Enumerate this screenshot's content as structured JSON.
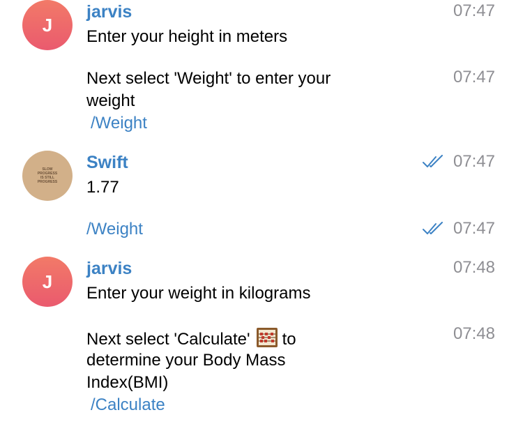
{
  "messages": [
    {
      "sender": "jarvis",
      "avatar_letter": "J",
      "text": "Enter your height in meters",
      "time": "07:47"
    },
    {
      "text_line1": "Next select 'Weight' to enter your",
      "text_line2": "weight",
      "command": "/Weight",
      "time": "07:47"
    },
    {
      "sender": "Swift",
      "avatar_text": [
        "SLOW",
        "PROGRESS",
        "IS STILL",
        "PROGRESS"
      ],
      "text": "1.77",
      "time": "07:47",
      "status": "read"
    },
    {
      "command": "/Weight",
      "time": "07:47",
      "status": "read"
    },
    {
      "sender": "jarvis",
      "avatar_letter": "J",
      "text": "Enter your weight in kilograms",
      "time": "07:48"
    },
    {
      "text_line1_before": "Next select 'Calculate'",
      "text_line1_after": "to",
      "emoji_icon": "abacus-icon",
      "text_line2": "determine your Body Mass",
      "text_line3": "Index(BMI)",
      "command": "/Calculate",
      "time": "07:48"
    }
  ],
  "colors": {
    "accent": "#3c82c4",
    "timestamp": "#8e8e93",
    "avatar_jarvis": "#ee6a6c",
    "avatar_swift": "#d2b089"
  }
}
